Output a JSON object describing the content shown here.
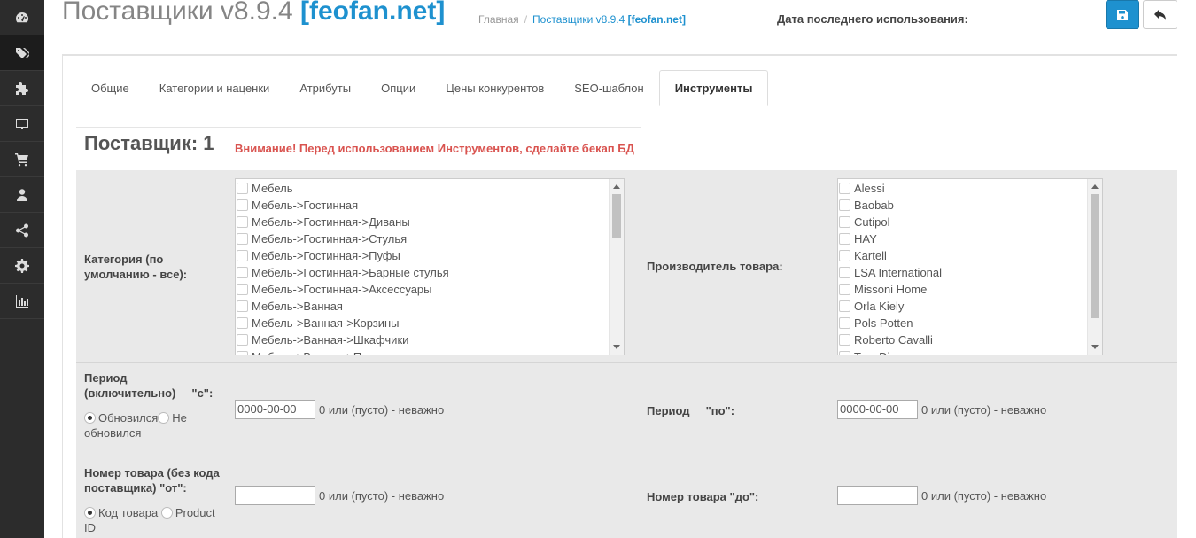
{
  "sidebar": {
    "items": [
      {
        "icon": "dashboard-icon"
      },
      {
        "icon": "tags-icon"
      },
      {
        "icon": "puzzle-icon"
      },
      {
        "icon": "monitor-icon"
      },
      {
        "icon": "cart-icon"
      },
      {
        "icon": "user-icon"
      },
      {
        "icon": "share-icon"
      },
      {
        "icon": "gear-icon"
      },
      {
        "icon": "bar-chart-icon"
      }
    ]
  },
  "header": {
    "title_main": "Поставщики v8.9.4 ",
    "title_brand": "[feofan.net]",
    "breadcrumb_home": "Главная",
    "breadcrumb_sep": "/",
    "breadcrumb_current": "Поставщики v8.9.4 ",
    "breadcrumb_current_brand": "[feofan.net]",
    "last_used_label": "Дата последнего использования:"
  },
  "tabs": [
    "Общие",
    "Категории и наценки",
    "Атрибуты",
    "Опции",
    "Цены конкурентов",
    "SEO-шаблон",
    "Инструменты"
  ],
  "active_tab": "Инструменты",
  "supplier": {
    "label": "Поставщик:  1",
    "warning": "Внимание! Перед использованием Инструментов, сделайте бекап БД"
  },
  "form": {
    "category_label": "Категория (по умолчанию - все):",
    "categories": [
      "Мебель",
      "Мебель->Гостинная",
      "Мебель->Гостинная->Диваны",
      "Мебель->Гостинная->Стулья",
      "Мебель->Гостинная->Пуфы",
      "Мебель->Гостинная->Барные стулья",
      "Мебель->Гостинная->Аксессуары",
      "Мебель->Ванная",
      "Мебель->Ванная->Корзины",
      "Мебель->Ванная->Шкафчики",
      "Мебель->Ванная->Полки"
    ],
    "manufacturer_label": "Производитель товара:",
    "manufacturers": [
      "Alessi",
      "Baobab",
      "Cutipol",
      "HAY",
      "Kartell",
      "LSA International",
      "Missoni Home",
      "Orla Kiely",
      "Pols Potten",
      "Roberto Cavalli",
      "Tom Dixon"
    ],
    "period_from_label": "Период (включительно)     \"с\":",
    "period_from_value": "0000-00-00",
    "period_hint": "0 или (пусто) - неважно",
    "radio_updated": "Обновился",
    "radio_not_updated": "Не обновился",
    "period_to_label": "Период     \"по\":",
    "period_to_value": "0000-00-00",
    "product_from_label": "Номер товара (без кода поставщика) \"от\":",
    "product_from_value": "",
    "product_hint": "0 или (пусто) - неважно",
    "radio_code": "Код товара",
    "radio_product_id": "Product ID",
    "product_to_label": "Номер товара \"до\":",
    "product_to_value": ""
  }
}
